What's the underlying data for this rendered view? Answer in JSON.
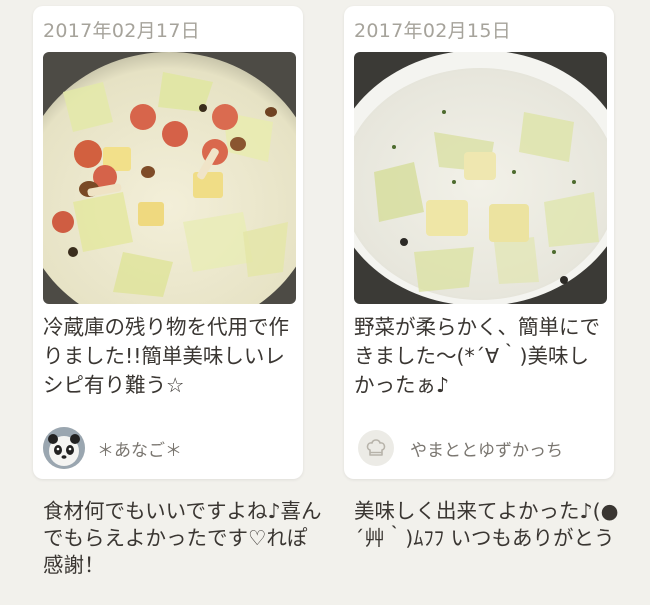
{
  "cards": [
    {
      "date": "2017年02月17日",
      "title": "冷蔵庫の残り物を代用で作りました!!簡単美味しいレシピ有り難う☆",
      "author": "＊あなご＊",
      "photo_icon": "cream-stew-with-sausage-photo",
      "avatar_icon": "panda-avatar",
      "comment": "食材何でもいいですよね♪喜んでもらえよかったです♡れぽ感謝！"
    },
    {
      "date": "2017年02月15日",
      "title": "野菜が柔らかく、簡単にできました〜(*´∀｀)美味しかったぁ♪",
      "author": "やまととゆずかっち",
      "photo_icon": "cream-soup-in-bowl-photo",
      "avatar_icon": "chef-hat-icon",
      "comment": "美味しく出来てよかった♪(●´艸｀)ﾑﾌﾌ いつもありがとう"
    }
  ],
  "colors": {
    "background": "#f2f1ec",
    "card": "#ffffff",
    "date_text": "#a6a39b",
    "body_text": "#3a3632"
  }
}
